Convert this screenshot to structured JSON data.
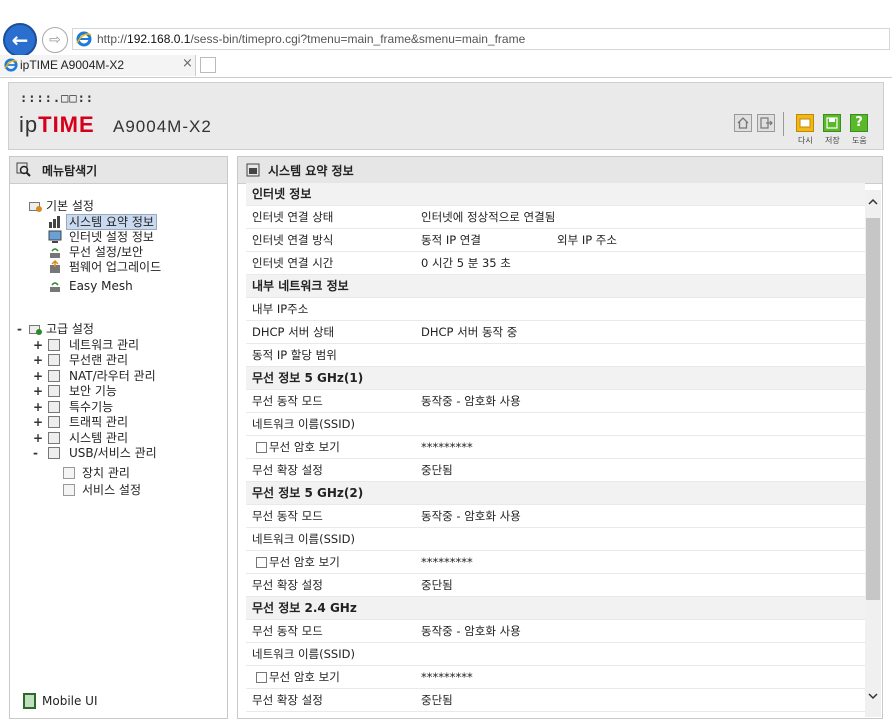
{
  "browser": {
    "url_prefix": "http://",
    "url_host": "192.168.0.1",
    "url_path": "/sess-bin/timepro.cgi?tmenu=main_frame&smenu=main_frame",
    "tab_title": "ipTIME A9004M-X2",
    "tab_close": "×"
  },
  "header": {
    "logo_dots": "::::.□□::",
    "logo_ip": "ip",
    "logo_time": "TIME",
    "model": "A9004M-X2",
    "buttons": [
      {
        "icon": "home-icon"
      },
      {
        "icon": "logout-icon"
      },
      {
        "icon": "refresh-icon",
        "label": "다시"
      },
      {
        "icon": "save-icon",
        "label": "저장"
      },
      {
        "icon": "help-icon",
        "glyph": "?",
        "label": "도움"
      }
    ]
  },
  "left": {
    "title": "메뉴탐색기",
    "basic": {
      "label": "기본 설정",
      "items": [
        "시스템 요약 정보",
        "인터넷 설정 정보",
        "무선 설정/보안",
        "펌웨어 업그레이드",
        "Easy Mesh"
      ]
    },
    "advanced": {
      "toggle": "-",
      "label": "고급 설정",
      "items": [
        {
          "pm": "+",
          "label": "네트워크 관리"
        },
        {
          "pm": "+",
          "label": "무선랜 관리"
        },
        {
          "pm": "+",
          "label": "NAT/라우터 관리"
        },
        {
          "pm": "+",
          "label": "보안 기능"
        },
        {
          "pm": "+",
          "label": "특수기능"
        },
        {
          "pm": "+",
          "label": "트래픽 관리"
        },
        {
          "pm": "+",
          "label": "시스템 관리"
        },
        {
          "pm": "-",
          "label": "USB/서비스 관리"
        }
      ],
      "usb_children": [
        "장치 관리",
        "서비스 설정"
      ]
    },
    "mobile_ui": "Mobile UI"
  },
  "right": {
    "title": "시스템 요약 정보",
    "rows": [
      {
        "type": "section",
        "label": "인터넷 정보"
      },
      {
        "type": "kv",
        "label": "인터넷 연결 상태",
        "value": "인터넷에 정상적으로 연결됨",
        "extra": ""
      },
      {
        "type": "kv",
        "label": "인터넷 연결 방식",
        "value": "동적 IP 연결",
        "extra": "외부 IP 주소"
      },
      {
        "type": "kv",
        "label": "인터넷 연결 시간",
        "value": "0 시간 5 분 35 초",
        "extra": ""
      },
      {
        "type": "section",
        "label": "내부 네트워크 정보"
      },
      {
        "type": "kv",
        "label": "내부 IP주소",
        "value": "",
        "extra": ""
      },
      {
        "type": "kv",
        "label": "DHCP 서버 상태",
        "value": "DHCP 서버 동작 중",
        "extra": ""
      },
      {
        "type": "kv",
        "label": "동적 IP 할당 범위",
        "value": "",
        "extra": ""
      },
      {
        "type": "section",
        "label": "무선 정보 5 GHz(1)"
      },
      {
        "type": "kv",
        "label": "무선 동작 모드",
        "value": "동작중 - 암호화 사용",
        "extra": ""
      },
      {
        "type": "kv",
        "label": "네트워크 이름(SSID)",
        "value": "",
        "extra": ""
      },
      {
        "type": "check",
        "label": "무선 암호 보기",
        "value": "*********",
        "extra": ""
      },
      {
        "type": "kv",
        "label": "무선 확장 설정",
        "value": "중단됨",
        "extra": ""
      },
      {
        "type": "section",
        "label": "무선 정보 5 GHz(2)"
      },
      {
        "type": "kv",
        "label": "무선 동작 모드",
        "value": "동작중 - 암호화 사용",
        "extra": ""
      },
      {
        "type": "kv",
        "label": "네트워크 이름(SSID)",
        "value": "",
        "extra": ""
      },
      {
        "type": "check",
        "label": "무선 암호 보기",
        "value": "*********",
        "extra": ""
      },
      {
        "type": "kv",
        "label": "무선 확장 설정",
        "value": "중단됨",
        "extra": ""
      },
      {
        "type": "section",
        "label": "무선 정보 2.4 GHz"
      },
      {
        "type": "kv",
        "label": "무선 동작 모드",
        "value": "동작중 - 암호화 사용",
        "extra": ""
      },
      {
        "type": "kv",
        "label": "네트워크 이름(SSID)",
        "value": "",
        "extra": ""
      },
      {
        "type": "check",
        "label": "무선 암호 보기",
        "value": "*********",
        "extra": ""
      },
      {
        "type": "kv",
        "label": "무선 확장 설정",
        "value": "중단됨",
        "extra": ""
      }
    ]
  }
}
